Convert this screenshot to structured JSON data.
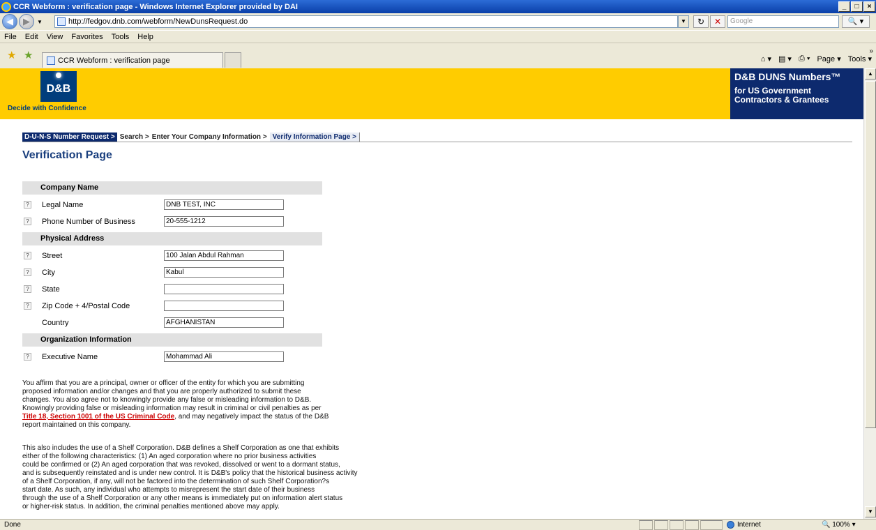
{
  "window": {
    "title": "CCR Webform : verification page - Windows Internet Explorer provided by DAI",
    "controls": [
      "_",
      "□",
      "×"
    ]
  },
  "address": {
    "url": "http://fedgov.dnb.com/webform/NewDunsRequest.do",
    "search_placeholder": "Google"
  },
  "menu": [
    "File",
    "Edit",
    "View",
    "Favorites",
    "Tools",
    "Help"
  ],
  "tab": {
    "label": "CCR Webform : verification page"
  },
  "commandbar": [
    "Page ▾",
    "Tools ▾"
  ],
  "banner": {
    "logo": "D&B",
    "tagline": "Decide with Confidence",
    "duns_title": "D&B DUNS Numbers™",
    "duns_sub1": "for US Government",
    "duns_sub2": "Contractors & Grantees"
  },
  "breadcrumb": {
    "step1": "D-U-N-S Number Request >",
    "step2": "Search >",
    "step3": "Enter Your Company Information >",
    "step4": "Verify Information Page >"
  },
  "page_title": "Verification Page",
  "form": {
    "company_section": "Company Name",
    "legal_name_label": "Legal Name",
    "legal_name_value": "DNB TEST, INC",
    "phone_label": "Phone Number of Business",
    "phone_value": "20-555-1212",
    "address_section": "Physical Address",
    "street_label": "Street",
    "street_value": "100 Jalan Abdul Rahman",
    "city_label": "City",
    "city_value": "Kabul",
    "state_label": "State",
    "state_value": "",
    "zip_label": "Zip Code + 4/Postal Code",
    "zip_value": "",
    "country_label": "Country",
    "country_value": "AFGHANISTAN",
    "org_section": "Organization Information",
    "exec_label": "Executive Name",
    "exec_value": "Mohammad Ali",
    "help_glyph": "?"
  },
  "affirm": {
    "line1": "You affirm that you are a principal, owner or officer of the entity for which you are submitting",
    "line2": "proposed information and/or changes and that you are properly authorized to submit these",
    "line3": "changes. You also agree not to knowingly provide any false or misleading information to D&B.",
    "line4": "Knowingly providing false or misleading information may result in criminal or civil penalties as per",
    "link": "Title 18, Section 1001 of the US Criminal Code",
    "line5_rest": ", and may negatively impact the status of the D&B",
    "line6": "report maintained on this company."
  },
  "shelf": {
    "line1": "This also includes the use of a Shelf Corporation. D&B defines a Shelf Corporation as one that exhibits",
    "line2": "either of the following characteristics: (1) An aged corporation where no prior business activities",
    "line3": "could be confirmed or (2) An aged corporation that was revoked, dissolved or went to a dormant status,",
    "line4": "and is subsequently reinstated and is under new control. It is D&B's policy that the historical business activity",
    "line5": "of a Shelf Corporation, if any, will not be factored into the determination of such Shelf Corporation?s",
    "line6": "start date. As such, any individual who attempts to misrepresent the start date of their business",
    "line7": "through the use of a Shelf Corporation or any other means is immediately put on information alert status",
    "line8": "or higher-risk status. In addition, the criminal penalties mentioned above may apply."
  },
  "status": {
    "text": "Done",
    "zone": "Internet",
    "zoom": "100%"
  }
}
